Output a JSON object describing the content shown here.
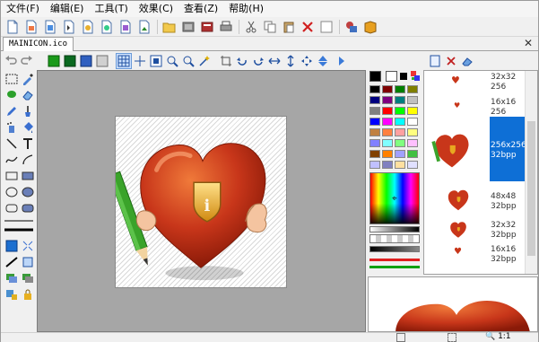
{
  "menu": [
    "文件(F)",
    "编辑(E)",
    "工具(T)",
    "效果(C)",
    "查看(Z)",
    "帮助(H)"
  ],
  "document": {
    "filename": "MAINICON.ico"
  },
  "toolbar_icons": [
    "new-icon",
    "new-from-image-icon",
    "open-icon",
    "save-icon",
    "save-as-icon",
    "export-icon",
    "extract-icon",
    "image-icon",
    "open-folder-icon",
    "capture-icon",
    "library-icon",
    "print-icon",
    "cut-icon",
    "copy-icon",
    "paste-icon",
    "delete-icon",
    "clear-icon",
    "resources-icon",
    "book-icon"
  ],
  "icon_sizes": [
    {
      "size": "32x32",
      "depth": "256"
    },
    {
      "size": "16x16",
      "depth": "256"
    },
    {
      "size": "256x256",
      "depth": "32bpp"
    },
    {
      "size": "48x48",
      "depth": "32bpp"
    },
    {
      "size": "32x32",
      "depth": "32bpp"
    },
    {
      "size": "16x16",
      "depth": "32bpp"
    }
  ],
  "selected_size_index": 2,
  "colors": {
    "selection": "#0e6fd6",
    "heart": "#c8361a",
    "shield": "#e8a820",
    "pencil": "#3aa32a"
  },
  "palette": [
    "#000000",
    "#7f0000",
    "#007f00",
    "#7f7f00",
    "#00007f",
    "#7f007f",
    "#007f7f",
    "#c0c0c0",
    "#808080",
    "#ff0000",
    "#00ff00",
    "#ffff00",
    "#0000ff",
    "#ff00ff",
    "#00ffff",
    "#ffffff",
    "#c08040",
    "#ff8040",
    "#ffa0a0",
    "#ffff80",
    "#8080ff",
    "#80ffff",
    "#80ff80",
    "#ffc0ff",
    "#804000",
    "#ff8000",
    "#a0a0ff",
    "#40c040",
    "#c0c0ff",
    "#8080c0",
    "#ffe0a0",
    "#e0e0ff"
  ],
  "status": {
    "zoom": "1:1"
  }
}
